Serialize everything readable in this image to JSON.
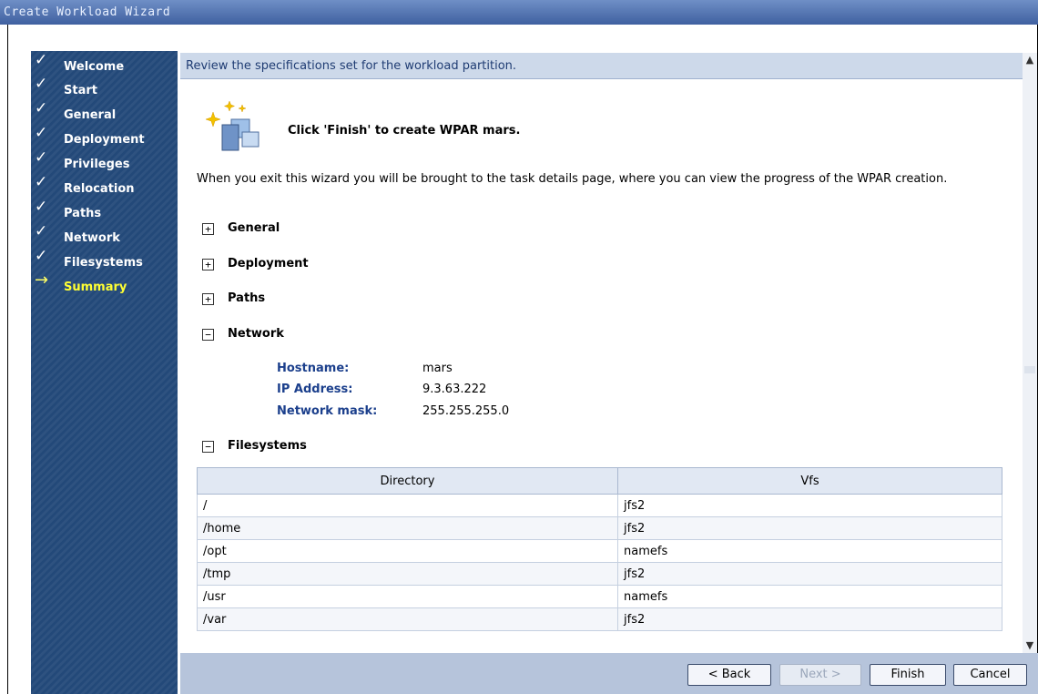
{
  "window": {
    "title": "Create Workload Wizard"
  },
  "steps": [
    {
      "label": "Welcome",
      "state": "done"
    },
    {
      "label": "Start",
      "state": "done"
    },
    {
      "label": "General",
      "state": "done"
    },
    {
      "label": "Deployment",
      "state": "done"
    },
    {
      "label": "Privileges",
      "state": "done"
    },
    {
      "label": "Relocation",
      "state": "done"
    },
    {
      "label": "Paths",
      "state": "done"
    },
    {
      "label": "Network",
      "state": "done"
    },
    {
      "label": "Filesystems",
      "state": "done"
    },
    {
      "label": "Summary",
      "state": "current"
    }
  ],
  "header": {
    "text": "Review the specifications set for the workload partition."
  },
  "banner": {
    "text": "Click 'Finish' to create WPAR mars."
  },
  "intro": "When you exit this wizard you will be brought to the task details page, where you can view the progress of the WPAR creation.",
  "sections": {
    "general": {
      "label": "General",
      "expanded": false,
      "toggle": "+"
    },
    "deployment": {
      "label": "Deployment",
      "expanded": false,
      "toggle": "+"
    },
    "paths": {
      "label": "Paths",
      "expanded": false,
      "toggle": "+"
    },
    "network": {
      "label": "Network",
      "expanded": true,
      "toggle": "−"
    },
    "filesystems": {
      "label": "Filesystems",
      "expanded": true,
      "toggle": "−"
    }
  },
  "network": {
    "hostname_label": "Hostname:",
    "hostname": "mars",
    "ip_label": "IP Address:",
    "ip": "9.3.63.222",
    "mask_label": "Network mask:",
    "mask": "255.255.255.0"
  },
  "filesystems": {
    "columns": [
      "Directory",
      "Vfs"
    ],
    "rows": [
      [
        "/",
        "jfs2"
      ],
      [
        "/home",
        "jfs2"
      ],
      [
        "/opt",
        "namefs"
      ],
      [
        "/tmp",
        "jfs2"
      ],
      [
        "/usr",
        "namefs"
      ],
      [
        "/var",
        "jfs2"
      ]
    ]
  },
  "buttons": {
    "back": "< Back",
    "next": "Next >",
    "finish": "Finish",
    "cancel": "Cancel"
  },
  "colors": {
    "nav_bg": "#234979",
    "current_step": "#ffff33",
    "header_bg": "#cdd9ea",
    "footer_bg": "#b6c4db"
  }
}
